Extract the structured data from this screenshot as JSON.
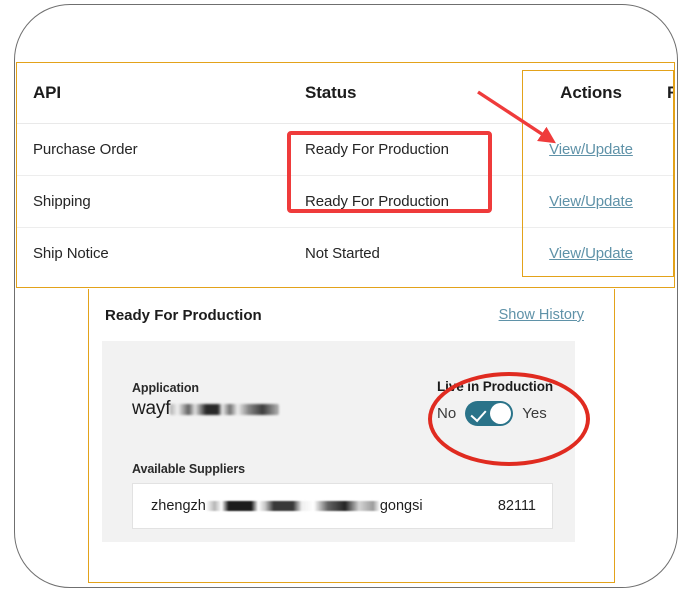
{
  "table": {
    "headers": {
      "api": "API",
      "status": "Status",
      "actions": "Actions",
      "clipped": "Re"
    },
    "rows": [
      {
        "api": "Purchase Order",
        "status": "Ready For Production",
        "action": "View/Update"
      },
      {
        "api": "Shipping",
        "status": "Ready For Production",
        "action": "View/Update"
      },
      {
        "api": "Ship Notice",
        "status": "Not Started",
        "action": "View/Update"
      }
    ]
  },
  "detail": {
    "status_title": "Ready For Production",
    "show_history": "Show History",
    "application_label": "Application",
    "application_value_visible": "wayf",
    "application_value_redacted": "airxxxxjxxxxx",
    "live_label": "Live in Production",
    "toggle_off_label": "No",
    "toggle_on_label": "Yes",
    "toggle_state": "Yes",
    "suppliers_label": "Available Suppliers",
    "supplier_name_visible": "zhengzh",
    "supplier_name_redacted": "xxxxxxxxxxxxxxxxxxxxxxxx",
    "supplier_name_tail": "gongsi",
    "supplier_id": "82111"
  },
  "colors": {
    "panel_border_orange": "#e3a21a",
    "link_blue": "#5f92a8",
    "toggle_teal": "#2a7389",
    "annotation_red": "#ef3b3b",
    "card_gray": "#f2f2f2"
  }
}
